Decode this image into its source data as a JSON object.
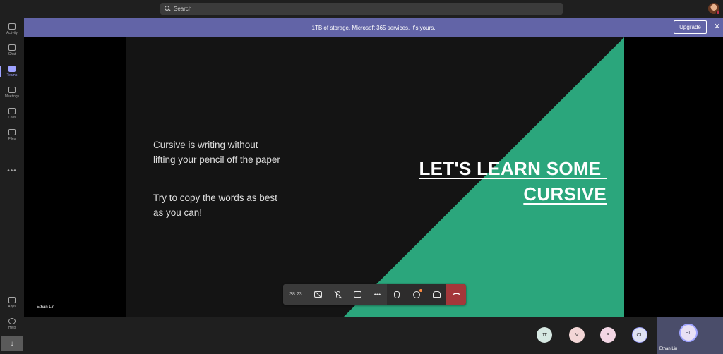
{
  "search": {
    "placeholder": "Search"
  },
  "rail": {
    "items": [
      {
        "label": "Activity",
        "icon": "bell-icon"
      },
      {
        "label": "Chat",
        "icon": "chat-icon"
      },
      {
        "label": "Teams",
        "icon": "teams-icon",
        "active": true
      },
      {
        "label": "Meetings",
        "icon": "calendar-icon"
      },
      {
        "label": "Calls",
        "icon": "phone-icon"
      },
      {
        "label": "Files",
        "icon": "file-icon"
      }
    ],
    "more": "•••",
    "apps": "Apps",
    "help": "Help"
  },
  "banner": {
    "text": "1TB of storage. Microsoft 365 services. It's yours.",
    "upgrade": "Upgrade",
    "close": "✕",
    "color": "#6264a7"
  },
  "slide": {
    "para1_line1": "Cursive is writing without",
    "para1_line2": "lifting your pencil off the paper",
    "para2_line1": "Try to copy the words as best",
    "para2_line2": "as you can!",
    "title_line1": "LET'S LEARN SOME ",
    "title_line2": "CURSIVE",
    "accent": "#2ba67c",
    "presenter": "Ethan Lin"
  },
  "controls": {
    "timer": "38:23",
    "items": [
      "camera-off-icon",
      "mic-off-icon",
      "share-screen-icon",
      "more-icon",
      "raise-hand-icon",
      "chat-icon",
      "participants-icon",
      "hang-up-icon"
    ]
  },
  "participants": [
    {
      "initials": "JT",
      "color": "#d6e8e2"
    },
    {
      "initials": "V",
      "color": "#f3d6d6"
    },
    {
      "initials": "S",
      "color": "#f2d6e4"
    },
    {
      "initials": "CL",
      "color": "#dfe2f2"
    }
  ],
  "self": {
    "initials": "EL",
    "name": "Ethan Lin"
  }
}
